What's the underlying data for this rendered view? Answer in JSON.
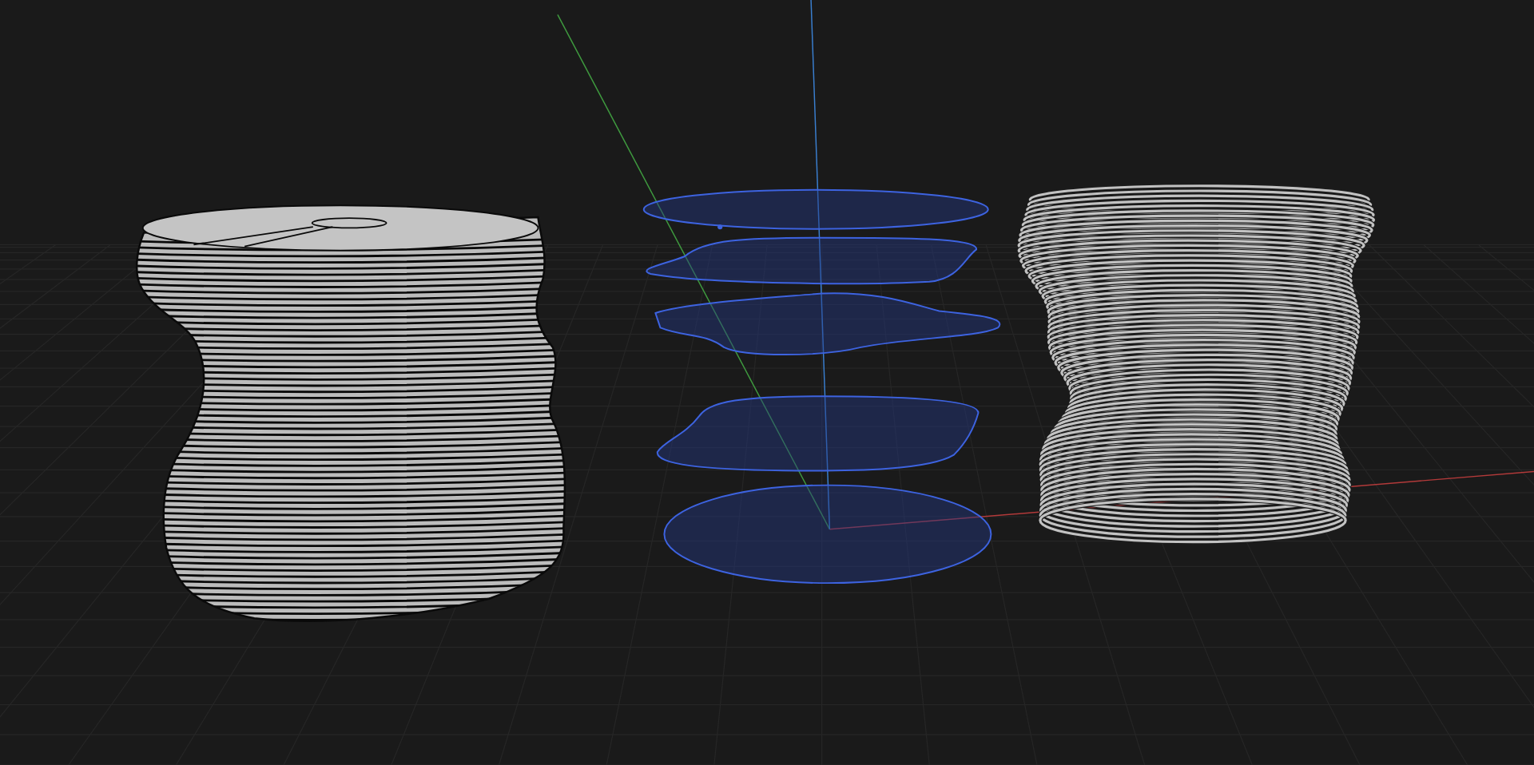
{
  "viewport": {
    "axes": [
      {
        "kind": "x"
      },
      {
        "kind": "y"
      },
      {
        "kind": "z"
      }
    ],
    "objects": [
      {
        "kind": "sliced-solid"
      },
      {
        "kind": "section-stack"
      },
      {
        "kind": "coil"
      }
    ]
  }
}
